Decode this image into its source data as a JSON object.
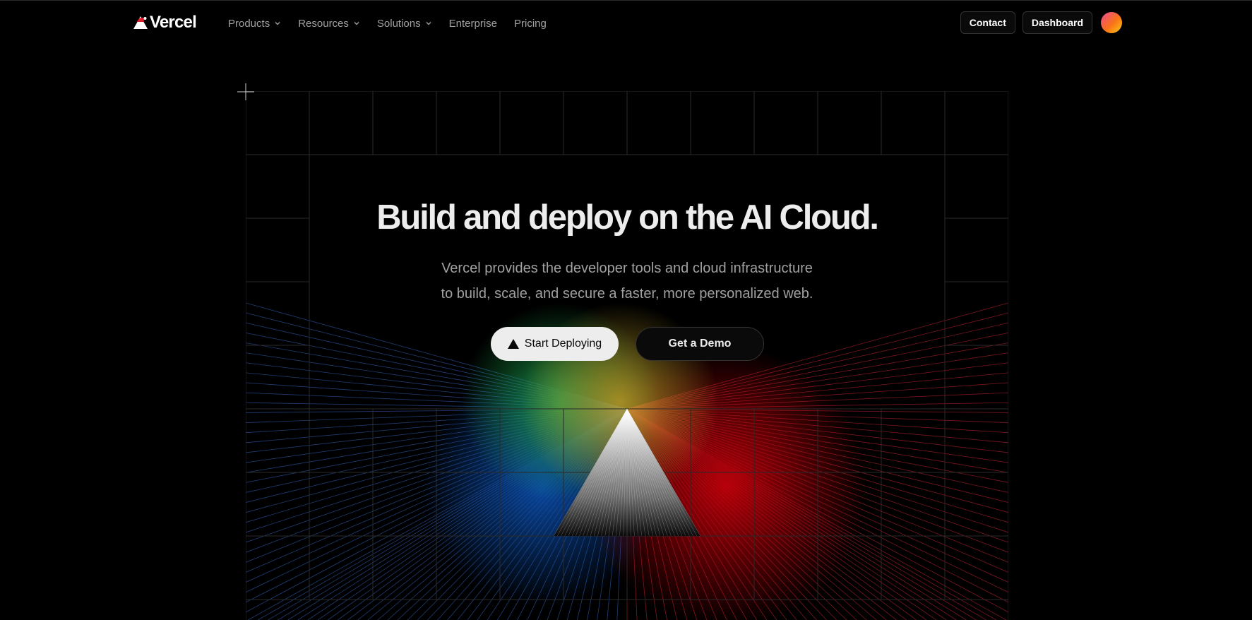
{
  "nav": {
    "logo_text": "Vercel",
    "links": [
      {
        "label": "Products",
        "has_menu": true
      },
      {
        "label": "Resources",
        "has_menu": true
      },
      {
        "label": "Solutions",
        "has_menu": true
      },
      {
        "label": "Enterprise",
        "has_menu": false
      },
      {
        "label": "Pricing",
        "has_menu": false
      }
    ],
    "contact_label": "Contact",
    "dashboard_label": "Dashboard"
  },
  "hero": {
    "headline": "Build and deploy on the AI Cloud.",
    "subline_1": "Vercel provides the developer tools and cloud infrastructure",
    "subline_2": "to build, scale, and secure a faster, more personalized web.",
    "primary_cta": "Start Deploying",
    "secondary_cta": "Get a Demo"
  },
  "colors": {
    "background": "#000000",
    "ray_left": "#3b6fd1",
    "ray_center_green": "#1aa34a",
    "ray_center_yellow": "#c9a227",
    "ray_right": "#e0283a"
  }
}
